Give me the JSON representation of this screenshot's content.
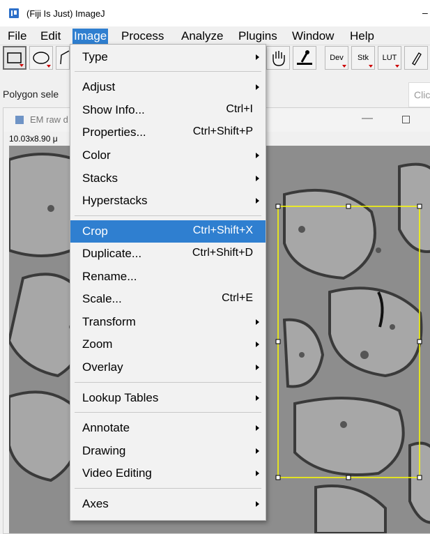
{
  "window": {
    "title": "(Fiji Is Just) ImageJ",
    "minimize": "–"
  },
  "menubar": [
    "File",
    "Edit",
    "Image",
    "Process",
    "Analyze",
    "Plugins",
    "Window",
    "Help"
  ],
  "active_menu": "Image",
  "toolbar": {
    "dev": "Dev",
    "stk": "Stk",
    "lut": "LUT"
  },
  "status": "Polygon sele",
  "search_placeholder": "Clic",
  "image_window": {
    "title": "EM raw d",
    "info": "10.03x8.90 μ"
  },
  "image_menu": [
    {
      "label": "Type",
      "submenu": true
    },
    {
      "label": "Adjust",
      "submenu": true
    },
    {
      "label": "Show Info...",
      "shortcut": "Ctrl+I"
    },
    {
      "label": "Properties...",
      "shortcut": "Ctrl+Shift+P"
    },
    {
      "label": "Color",
      "submenu": true
    },
    {
      "label": "Stacks",
      "submenu": true
    },
    {
      "label": "Hyperstacks",
      "submenu": true
    },
    {
      "label": "Crop",
      "shortcut": "Ctrl+Shift+X",
      "highlighted": true
    },
    {
      "label": "Duplicate...",
      "shortcut": "Ctrl+Shift+D"
    },
    {
      "label": "Rename..."
    },
    {
      "label": "Scale...",
      "shortcut": "Ctrl+E"
    },
    {
      "label": "Transform",
      "submenu": true
    },
    {
      "label": "Zoom",
      "submenu": true
    },
    {
      "label": "Overlay",
      "submenu": true
    },
    {
      "label": "Lookup Tables",
      "submenu": true
    },
    {
      "label": "Annotate",
      "submenu": true
    },
    {
      "label": "Drawing",
      "submenu": true
    },
    {
      "label": "Video Editing",
      "submenu": true
    },
    {
      "label": "Axes",
      "submenu": true
    }
  ],
  "colors": {
    "highlight": "#2f7fd0",
    "roi": "#ffff00"
  }
}
